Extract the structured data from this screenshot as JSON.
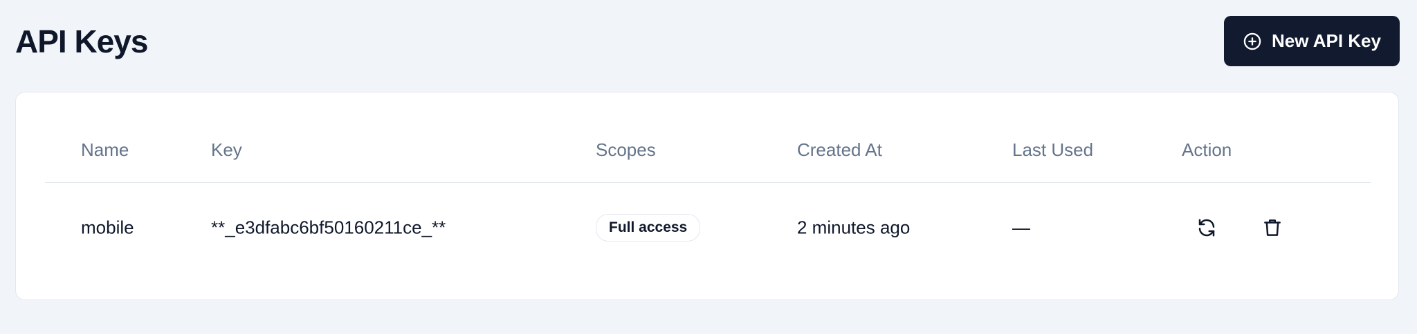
{
  "page": {
    "title": "API Keys"
  },
  "header": {
    "new_key_label": "New API Key",
    "new_key_icon": "plus-circle-icon"
  },
  "table": {
    "columns": {
      "name": "Name",
      "key": "Key",
      "scopes": "Scopes",
      "created_at": "Created At",
      "last_used": "Last Used",
      "action": "Action"
    },
    "rows": [
      {
        "name": "mobile",
        "key": "**_e3dfabc6bf50160211ce_**",
        "scope": "Full access",
        "created_at": "2 minutes ago",
        "last_used": "—",
        "actions": [
          "refresh-icon",
          "trash-icon"
        ]
      }
    ]
  },
  "colors": {
    "background": "#f1f4f8",
    "primary_button": "#111a2e",
    "header_text": "#64748b",
    "body_text": "#0f172a",
    "border": "#e2e8f0"
  }
}
